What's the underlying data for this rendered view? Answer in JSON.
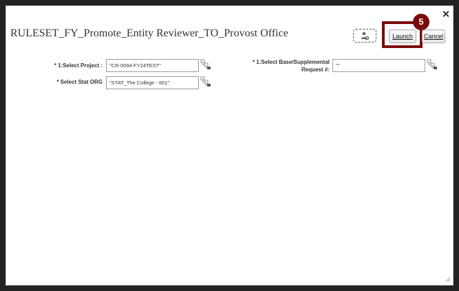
{
  "dialog": {
    "title": "RULESET_FY_Promote_Entity Reviewer_TO_Provost Office",
    "close_glyph": "×"
  },
  "toolbar": {
    "user_icon": "user-settings-icon",
    "launch_label": "Launch",
    "cancel_label": "Cancel",
    "step_badge": "5",
    "highlight_color": "#7a0a0a"
  },
  "form": {
    "project": {
      "label": "* 1:Select Project :",
      "value": "\"CR-0094-FY24TEST\""
    },
    "stat_org": {
      "label": "* Select Stat ORG",
      "value": "\"STAT_The College - 601\""
    },
    "base_supplemental": {
      "label_line1": "* 1:Select Base/Supplemental",
      "label_line2": "Request #:",
      "value": "\"\""
    }
  }
}
